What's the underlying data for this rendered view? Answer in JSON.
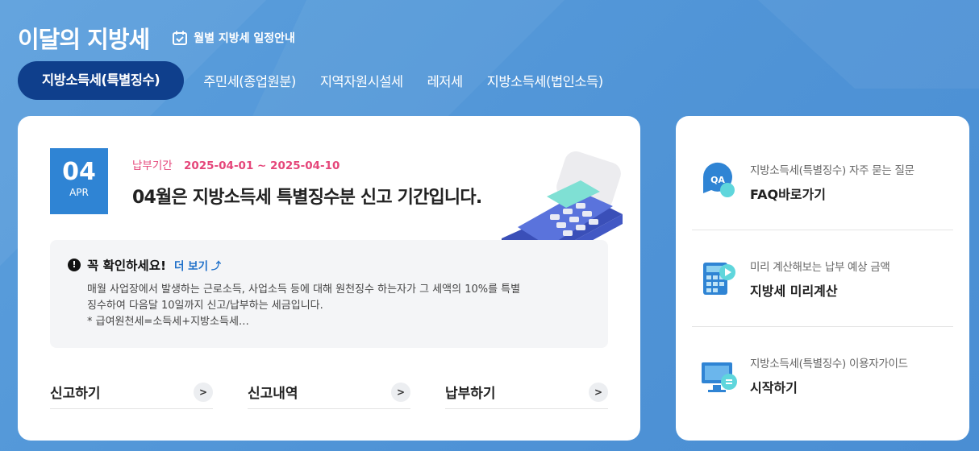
{
  "header": {
    "title": "이달의 지방세",
    "schedule_label": "월별 지방세 일정안내"
  },
  "tabs": [
    {
      "label": "지방소득세(특별징수)",
      "active": true
    },
    {
      "label": "주민세(종업원분)"
    },
    {
      "label": "지역자원시설세"
    },
    {
      "label": "레저세"
    },
    {
      "label": "지방소득세(법인소득)"
    }
  ],
  "main": {
    "date_month": "04",
    "date_abbr": "APR",
    "period_label": "납부기간",
    "period_value": "2025-04-01 ~ 2025-04-10",
    "headline": "04월은 지방소득세 특별징수분 신고 기간입니다.",
    "notice": {
      "title": "꼭 확인하세요!",
      "more_label": "더 보기",
      "line1": "매월 사업장에서 발생하는 근로소득, 사업소득 등에 대해 원천징수 하는자가 그 세액의 10%를 특별",
      "line2": "징수하여 다음달 10일까지 신고/납부하는 세금입니다.",
      "line3": "* 급여원천세=소득세+지방소득세…"
    },
    "actions": [
      {
        "label": "신고하기"
      },
      {
        "label": "신고내역"
      },
      {
        "label": "납부하기"
      }
    ]
  },
  "side": {
    "items": [
      {
        "desc": "지방소득세(특별징수) 자주 묻는 질문",
        "title": "FAQ바로가기",
        "icon": "qa-chat-icon",
        "icon_text": "QA"
      },
      {
        "desc": "미리 계산해보는 납부 예상 금액",
        "title": "지방세 미리계산",
        "icon": "calculator-icon"
      },
      {
        "desc": "지방소득세(특별징수) 이용자가이드",
        "title": "시작하기",
        "icon": "monitor-guide-icon"
      }
    ]
  },
  "colors": {
    "background": "#4f93d6",
    "active_tab": "#0f3f8c",
    "date_box": "#2f84d4",
    "period_text": "#e5467a",
    "link": "#1d6fc9"
  }
}
